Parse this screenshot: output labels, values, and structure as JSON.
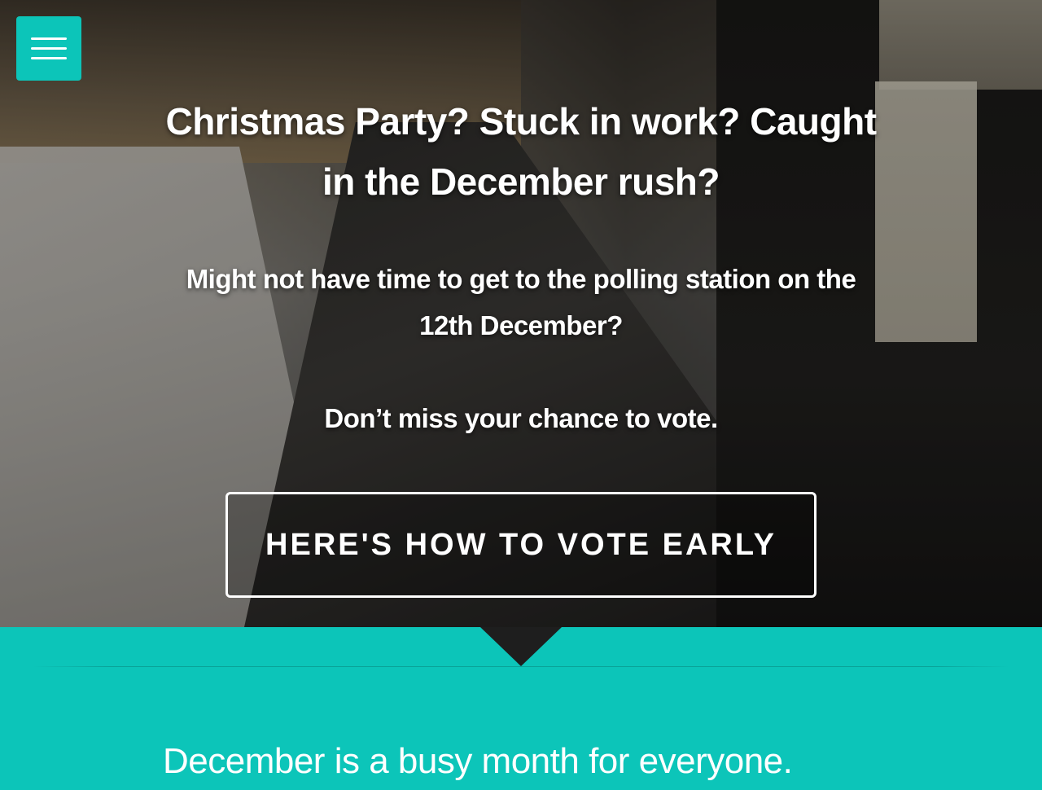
{
  "hero": {
    "headline_line1": "Christmas Party? Stuck in work? Caught",
    "headline_line2": "in the December rush?",
    "subline_line1": "Might not have time to get to the polling station on the",
    "subline_line2": "12th December?",
    "note": "Don’t miss your chance to vote.",
    "cta_label": "HERE'S HOW TO VOTE EARLY"
  },
  "menu": {
    "icon": "hamburger-menu-icon"
  },
  "section": {
    "lead": "December is a busy month for everyone."
  },
  "colors": {
    "accent": "#0cc5b9",
    "text_on_dark": "#ffffff",
    "pointer": "#1e1e1e"
  }
}
